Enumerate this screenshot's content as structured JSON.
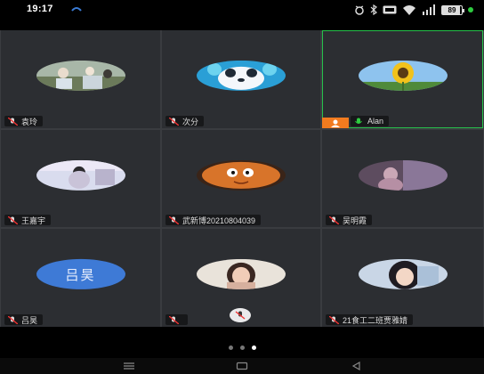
{
  "status_bar": {
    "time": "19:17",
    "battery": "89",
    "battery_level": 0.89,
    "icons": [
      "notification-icon",
      "alarm-icon",
      "bluetooth-icon",
      "hd-icon",
      "wifi-icon",
      "signal-icon",
      "battery-icon",
      "charging-icon"
    ]
  },
  "grid": {
    "tiles": [
      {
        "name": "袁玲",
        "avatar": "photo-group"
      },
      {
        "name": "次分",
        "avatar": "panda-cartoon"
      },
      {
        "name": "Alan",
        "avatar": "sunflower",
        "active": true,
        "host": true
      },
      {
        "name": "王嘉宇",
        "avatar": "photo-portrait"
      },
      {
        "name": "武新博20210804039",
        "avatar": "cartoon-face"
      },
      {
        "name": "吴明霞",
        "avatar": "photo-pink"
      },
      {
        "name": "吕昊",
        "avatar_text": "吕昊",
        "avatar_color": "#3e7ad6"
      },
      {
        "name": "",
        "avatar": "photo-girl"
      },
      {
        "name": "21食工二班贾雅婧",
        "avatar": "photo-smiling"
      }
    ]
  },
  "pager": {
    "pages": 3,
    "current": 3
  },
  "nav": {
    "icons": [
      "menu-icon",
      "home-icon",
      "back-icon"
    ]
  }
}
